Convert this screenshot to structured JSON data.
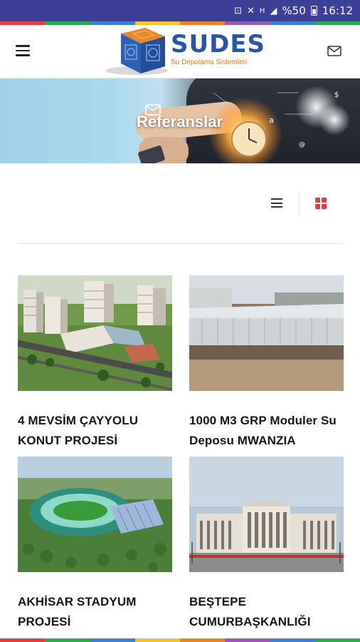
{
  "status_bar": {
    "left_icons": [
      "sim-alert-icon",
      "mute-icon",
      "signal-icon"
    ],
    "signal_label": "H",
    "battery": "%50",
    "time": "16:12"
  },
  "color_strip": [
    "#e33d3d",
    "#2fa84f",
    "#3f7fd1",
    "#f1c232",
    "#e8842a",
    "#9b59b6",
    "#3f7fd1",
    "#2fa84f"
  ],
  "header": {
    "menu_icon": "hamburger-menu-icon",
    "logo_text": "SUDES",
    "logo_subtitle": "Su Depolama Sistemleri",
    "mail_icon": "mail-icon"
  },
  "hero": {
    "title": "Referanslar"
  },
  "toolbar": {
    "list_view_icon": "list-view-icon",
    "grid_view_icon": "grid-view-icon",
    "active_view": "grid"
  },
  "projects": [
    {
      "title_line1": "4 MEVSİM ÇAYYOLU",
      "title_line2": "KONUT PROJESİ"
    },
    {
      "title_line1": "1000 M3 GRP Moduler Su",
      "title_line2": "Deposu MWANZIA"
    },
    {
      "title_line1": "AKHİSAR STADYUM",
      "title_line2": "PROJESİ"
    },
    {
      "title_line1": "BEŞTEPE",
      "title_line2": "CUMURBAŞKANLIĞI"
    }
  ],
  "colors": {
    "status_bar": "#3b3f95",
    "logo_blue": "#2a55a7",
    "logo_orange": "#e07a17",
    "grid_active": "#e33d3d"
  }
}
